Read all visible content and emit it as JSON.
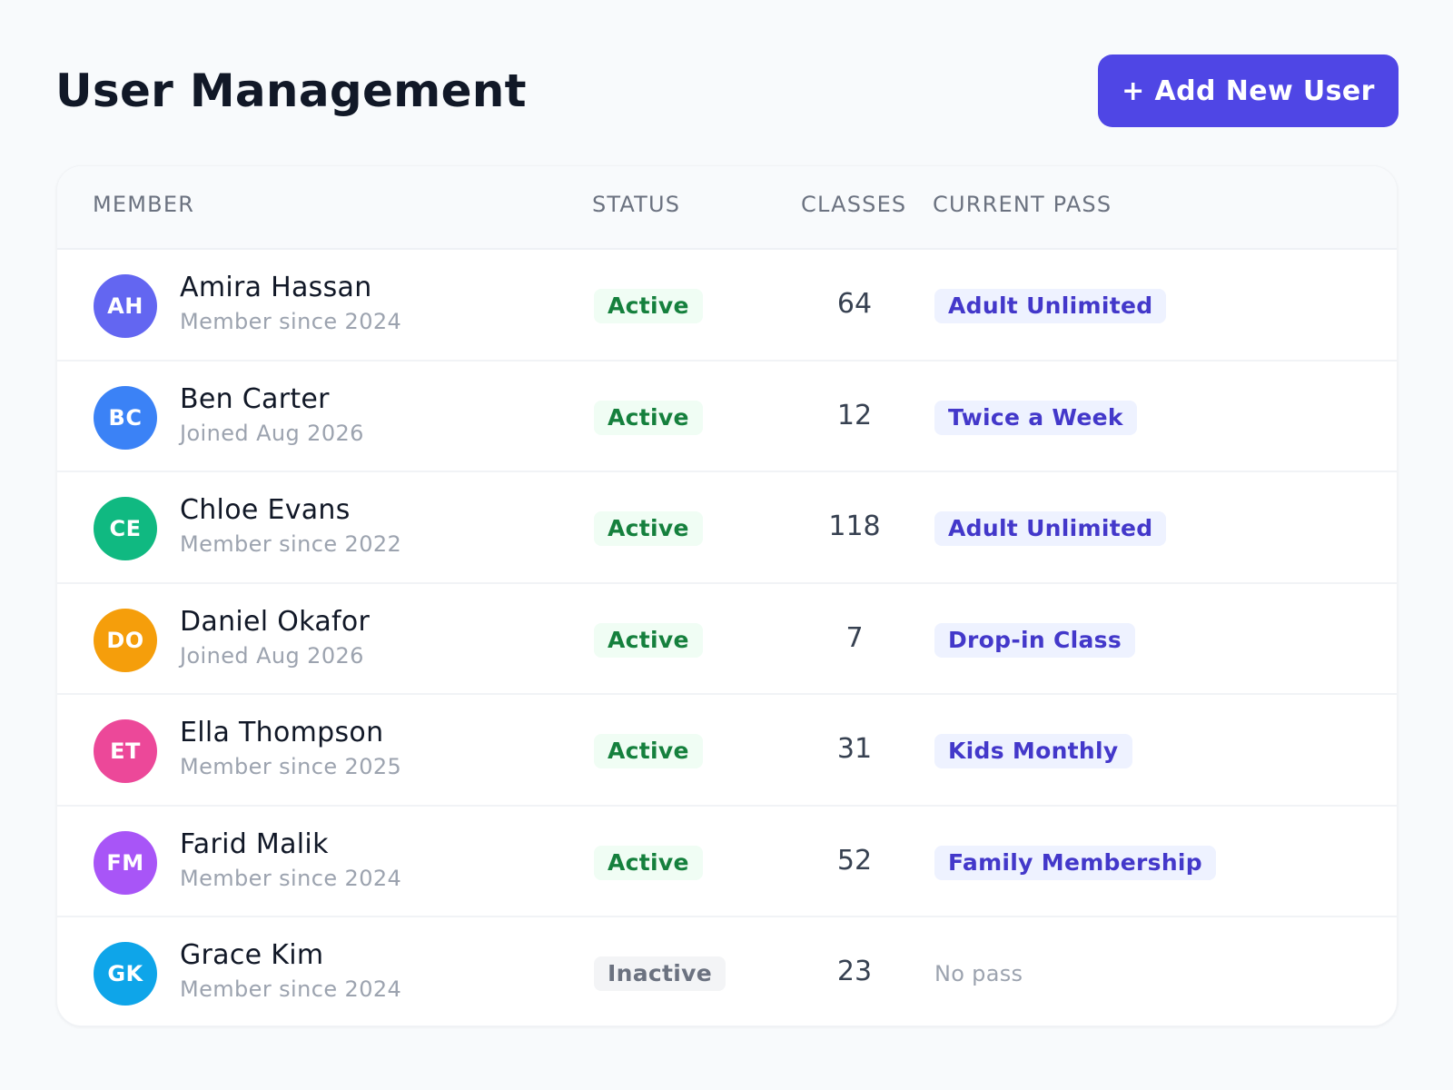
{
  "header": {
    "title": "User Management",
    "add_button_label": "+ Add New User",
    "accent_color": "#4f46e5"
  },
  "table": {
    "columns": [
      "MEMBER",
      "STATUS",
      "CLASSES",
      "CURRENT PASS"
    ],
    "rows": [
      {
        "initials": "AH",
        "avatar_color": "#6366f1",
        "name": "Amira Hassan",
        "subtitle": "Member since 2024",
        "status": "Active",
        "classes": "64",
        "pass": "Adult Unlimited"
      },
      {
        "initials": "BC",
        "avatar_color": "#3b82f6",
        "name": "Ben Carter",
        "subtitle": "Joined Aug 2026",
        "status": "Active",
        "classes": "12",
        "pass": "Twice a Week"
      },
      {
        "initials": "CE",
        "avatar_color": "#10b981",
        "name": "Chloe Evans",
        "subtitle": "Member since 2022",
        "status": "Active",
        "classes": "118",
        "pass": "Adult Unlimited"
      },
      {
        "initials": "DO",
        "avatar_color": "#f59e0b",
        "name": "Daniel Okafor",
        "subtitle": "Joined Aug 2026",
        "status": "Active",
        "classes": "7",
        "pass": "Drop-in Class"
      },
      {
        "initials": "ET",
        "avatar_color": "#ec4899",
        "name": "Ella Thompson",
        "subtitle": "Member since 2025",
        "status": "Active",
        "classes": "31",
        "pass": "Kids Monthly"
      },
      {
        "initials": "FM",
        "avatar_color": "#a855f7",
        "name": "Farid Malik",
        "subtitle": "Member since 2024",
        "status": "Active",
        "classes": "52",
        "pass": "Family Membership"
      },
      {
        "initials": "GK",
        "avatar_color": "#0ea5e9",
        "name": "Grace Kim",
        "subtitle": "Member since 2024",
        "status": "Inactive",
        "classes": "23",
        "pass": "No pass"
      }
    ]
  }
}
